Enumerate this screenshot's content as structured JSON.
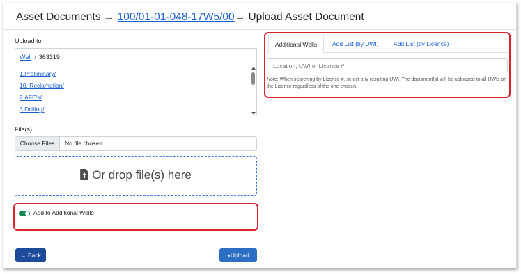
{
  "header": {
    "title_prefix": "Asset Documents →",
    "link": "100/01-01-048-17W5/00",
    "title_suffix": "→ Upload Asset Document"
  },
  "upload_to": {
    "label": "Upload to",
    "breadcrumb": {
      "root": "Well",
      "separator": "/",
      "current": "363319"
    },
    "folders": [
      "1.Preliminary/",
      "10. Reclamation/",
      "2.AFE's/",
      "3.Drilling/"
    ]
  },
  "files": {
    "label": "File(s)",
    "choose_button": "Choose Files",
    "status": "No file chosen",
    "drop_text": "Or drop file(s) here"
  },
  "additional_wells_toggle": {
    "label": "Add to Additional Wells",
    "checked": true
  },
  "buttons": {
    "back": "Back",
    "upload": "Upload"
  },
  "tabs": [
    "Additional Wells",
    "Add List (by UWI)",
    "Add List (by Licence)"
  ],
  "search": {
    "placeholder": "Location, UWI or Licence #",
    "value": ""
  },
  "note": "Note: When searching by Licence #, select any resulting UWI. The document(s) will be uploaded to all UWIs on the Licence regardless of the one chosen.",
  "colors": {
    "link": "#1a5fd0",
    "highlight": "#d9232d",
    "toggle_on": "#198754",
    "back_button": "#1e4a9a",
    "upload_button": "#2d6fc4"
  },
  "icons": [
    "arrow-left-icon",
    "upload-icon",
    "file-upload-icon"
  ]
}
